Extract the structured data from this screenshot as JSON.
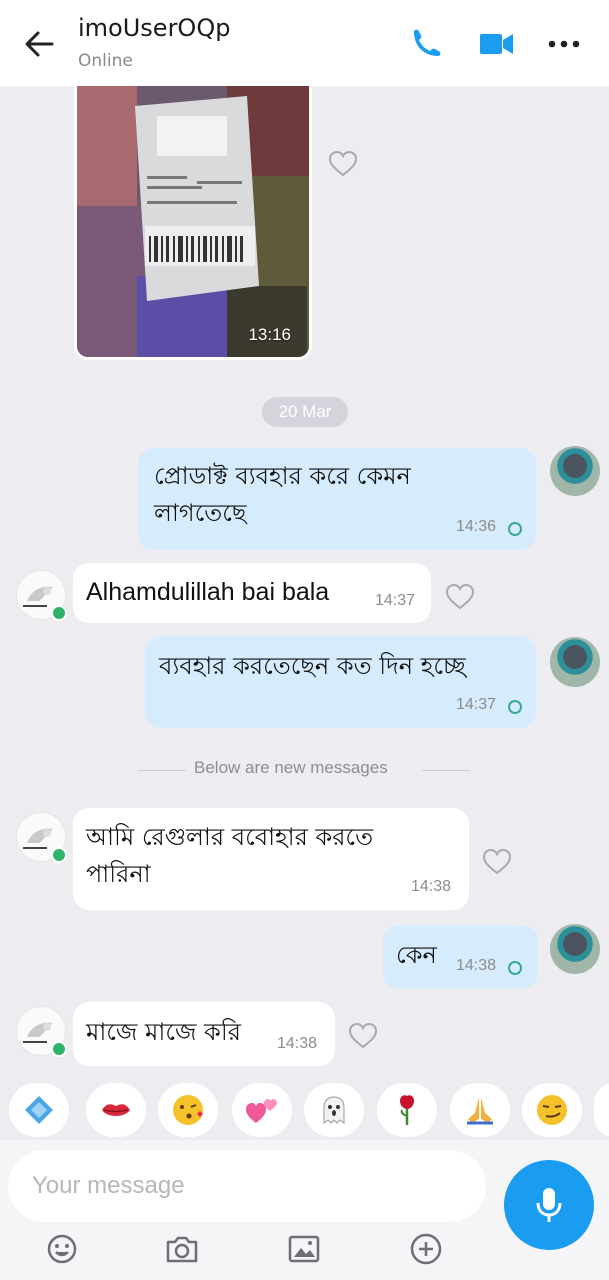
{
  "header": {
    "title": "imoUserOQp",
    "status": "Online",
    "icons": {
      "back": "back-arrow-icon",
      "call": "phone-icon",
      "video": "video-camera-icon",
      "more": "more-dots-icon"
    },
    "accent_color": "#1a9cf0"
  },
  "chat": {
    "photo_message": {
      "time": "13:16"
    },
    "date_separator": "20 Mar",
    "new_messages_divider": "Below are new messages",
    "messages": [
      {
        "direction": "out",
        "text_line1": "প্রোডাক্ট ব্যবহার করে কেমন",
        "text_line2": "লাগতেছে",
        "time": "14:36"
      },
      {
        "direction": "in",
        "text": "Alhamdulillah bai bala",
        "time": "14:37"
      },
      {
        "direction": "out",
        "text": "ব্যবহার করতেছেন কত দিন হচ্ছে",
        "time": "14:37"
      },
      {
        "direction": "in",
        "text_line1": "আমি রেগুলার ববোহার করতে",
        "text_line2": "পারিনা",
        "time": "14:38"
      },
      {
        "direction": "out",
        "text": "কেন",
        "time": "14:38"
      },
      {
        "direction": "in",
        "text": "মাজে মাজে করি",
        "time": "14:38"
      }
    ],
    "colors": {
      "outgoing_bubble": "#d6ecfc",
      "incoming_bubble": "#ffffff",
      "tick": "#39a6a0"
    }
  },
  "stickers": [
    "gem-sticker",
    "lips-sticker",
    "kiss-face-sticker",
    "hearts-sticker",
    "ghost-sticker",
    "rose-sticker",
    "pray-hands-sticker",
    "smirk-face-sticker"
  ],
  "composer": {
    "placeholder": "Your message",
    "icons": [
      "emoji-icon",
      "camera-icon",
      "gallery-icon",
      "plus-icon"
    ],
    "mic_icon": "microphone-icon"
  }
}
